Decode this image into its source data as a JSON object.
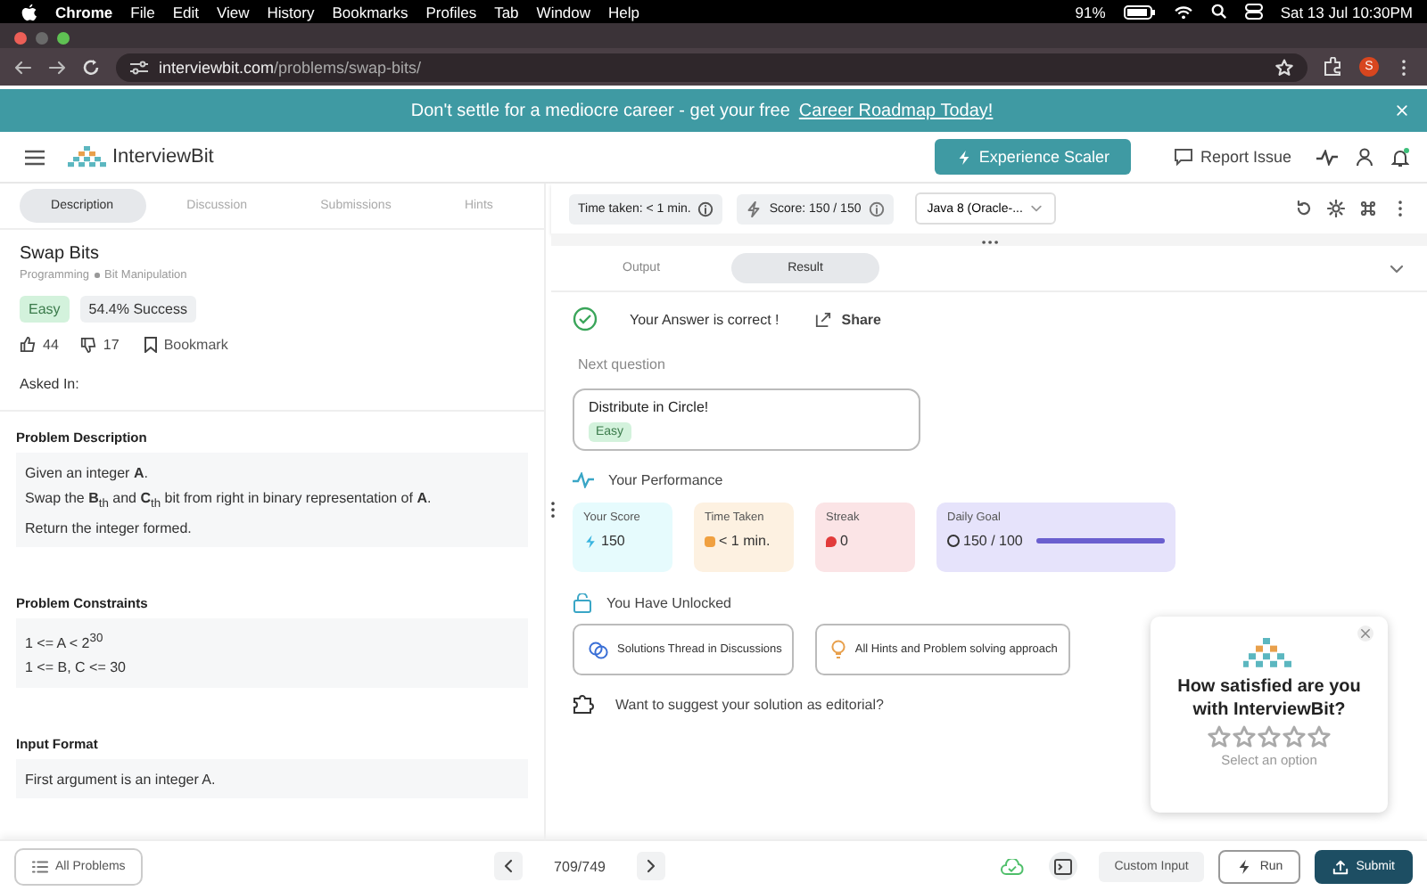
{
  "menubar": {
    "app": "Chrome",
    "menus": [
      "File",
      "Edit",
      "View",
      "History",
      "Bookmarks",
      "Profiles",
      "Tab",
      "Window",
      "Help"
    ],
    "battery": "91%",
    "clock": "Sat 13 Jul  10:30PM"
  },
  "browser": {
    "url_host": "interviewbit.com",
    "url_path": "/problems/swap-bits/",
    "profile": "S"
  },
  "banner": {
    "text": "Don't settle for a mediocre career - get your free",
    "link": "Career Roadmap Today!"
  },
  "header": {
    "logo": "InterviewBit",
    "cta": "Experience Scaler",
    "report": "Report Issue"
  },
  "left_tabs": [
    {
      "label": "Description",
      "selected": true
    },
    {
      "label": "Discussion",
      "selected": false
    },
    {
      "label": "Submissions",
      "selected": false
    },
    {
      "label": "Hints",
      "selected": false
    }
  ],
  "problem": {
    "title": "Swap Bits",
    "breadcrumbs": [
      "Programming",
      "Bit Manipulation"
    ],
    "difficulty": "Easy",
    "success": "54.4% Success",
    "likes": "44",
    "dislikes": "17",
    "bookmark": "Bookmark",
    "asked_in": "Asked In:"
  },
  "sections": [
    {
      "heading": "Problem Description",
      "lines": [
        "Given an integer **A**.",
        "Swap the **B**$_{th}$ and **C**$_{th}$ bit from right in binary representation of **A**.",
        "Return the integer formed."
      ]
    },
    {
      "heading": "Problem Constraints",
      "lines": [
        "1 <= A < 2$^{30}$",
        "1 <= B, C <= 30"
      ]
    },
    {
      "heading": "Input Format",
      "lines": [
        "First argument is an integer A."
      ]
    }
  ],
  "toolbar": {
    "time": "Time taken: < 1 min.",
    "score": "Score: 150 / 150",
    "language": "Java 8 (Oracle-..."
  },
  "result_tabs": [
    {
      "label": "Output",
      "selected": false
    },
    {
      "label": "Result",
      "selected": true
    }
  ],
  "result": {
    "message": "Your Answer is correct !",
    "share": "Share",
    "next_label": "Next question",
    "next_title": "Distribute in Circle!",
    "next_difficulty": "Easy",
    "performance_heading": "Your Performance",
    "unlocked_heading": "You Have Unlocked",
    "editorial": "Want to suggest your solution as editorial?"
  },
  "performance": [
    {
      "kind": "score",
      "label": "Your Score",
      "value": "150"
    },
    {
      "kind": "time",
      "label": "Time Taken",
      "value": "< 1 min."
    },
    {
      "kind": "streak",
      "label": "Streak",
      "value": "0"
    },
    {
      "kind": "goal",
      "label": "Daily Goal",
      "value": "150 / 100",
      "level": 1
    }
  ],
  "unlocked": [
    {
      "kind": "discussion",
      "label": "Solutions Thread in Discussions"
    },
    {
      "kind": "hints",
      "label": "All Hints and Problem solving approach"
    }
  ],
  "feedback": {
    "title": "How satisfied are you with InterviewBit?",
    "stars": 0,
    "hint": "Select an option"
  },
  "bottom": {
    "all_problems": "All Problems",
    "pager": "709/749",
    "custom_input": "Custom Input",
    "run": "Run",
    "submit": "Submit"
  }
}
